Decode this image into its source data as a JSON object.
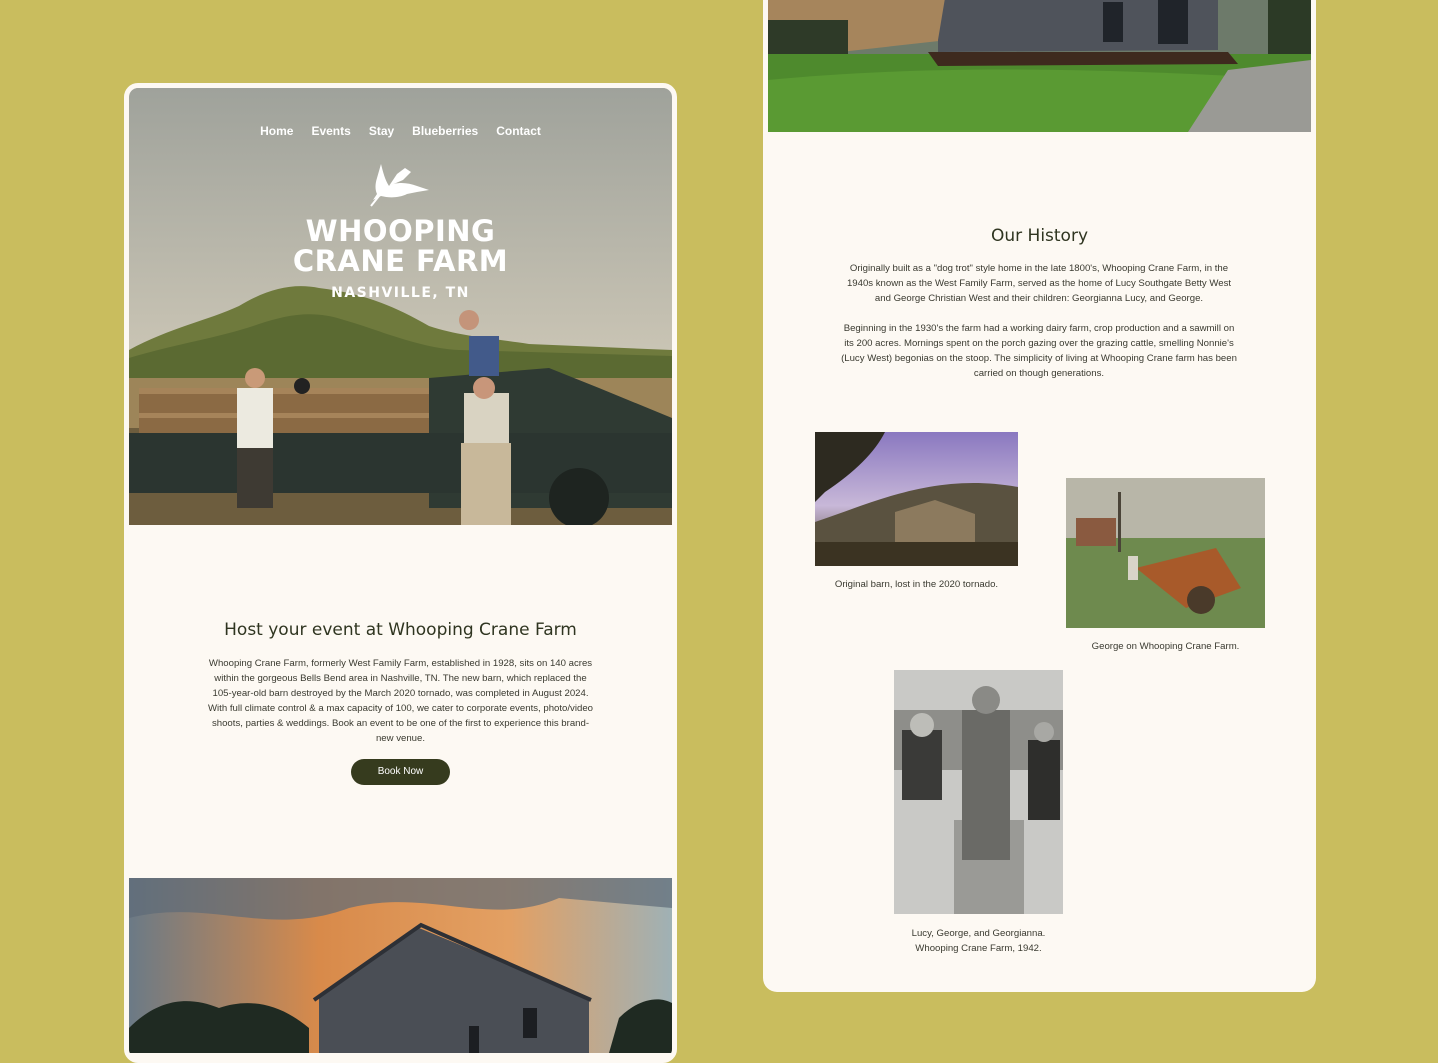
{
  "nav": {
    "items": [
      "Home",
      "Events",
      "Stay",
      "Blueberries",
      "Contact"
    ]
  },
  "logo": {
    "line1": "WHOOPING",
    "line2": "CRANE FARM",
    "location": "NASHVILLE, TN"
  },
  "host": {
    "title": "Host your event at Whooping Crane Farm",
    "body": "Whooping Crane Farm, formerly West Family Farm, established in 1928, sits on 140 acres within the gorgeous Bells Bend area in Nashville, TN. The new barn, which replaced the 105-year-old barn destroyed by the March 2020 tornado, was completed in August 2024. With full climate control & a max capacity of 100, we cater to corporate events, photo/video shoots, parties & weddings. Book an event to be one of the first to experience this brand-new venue.",
    "button": "Book Now"
  },
  "history": {
    "title": "Our History",
    "p1": "Originally built as a \"dog trot\" style home in the late 1800's, Whooping Crane Farm, in the 1940s known as the West Family Farm, served as the home of Lucy Southgate Betty West and  George Christian West and their children: Georgianna Lucy, and George.",
    "p2": "Beginning in the 1930's the farm had a working dairy farm, crop production and a sawmill on its 200 acres. Mornings spent on the porch gazing over the grazing cattle, smelling Nonnie's (Lucy West) begonias on the stoop. The simplicity of living at Whooping Crane farm has been carried on though generations.",
    "captions": {
      "barn": "Original barn, lost in the 2020 tornado.",
      "george": "George on Whooping Crane Farm.",
      "family_line1": "Lucy, George, and Georgianna.",
      "family_line2": "Whooping Crane Farm, 1942."
    }
  },
  "colors": {
    "background": "#c9bd5e",
    "panel": "#fdf9f3",
    "button": "#363b1e",
    "heading": "#2f3520"
  }
}
